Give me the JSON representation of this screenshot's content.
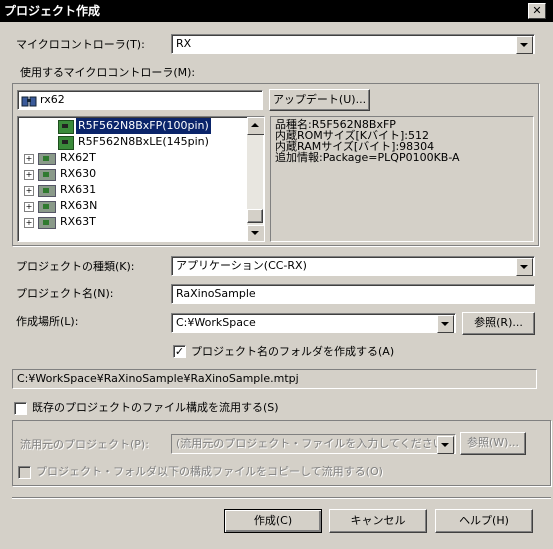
{
  "window": {
    "title": "プロジェクト作成",
    "close_glyph": "✕"
  },
  "microcontroller": {
    "label": "マイクロコントローラ(T):",
    "value": "RX"
  },
  "used_mc": {
    "label": "使用するマイクロコントローラ(M):",
    "search_value": "rx62",
    "update_button": "アップデート(U)...",
    "tree": [
      {
        "label": "R5F562N8BxFP(100pin)",
        "selected": true
      },
      {
        "label": "R5F562N8BxLE(145pin)",
        "selected": false
      },
      {
        "label": "RX62T"
      },
      {
        "label": "RX630"
      },
      {
        "label": "RX631"
      },
      {
        "label": "RX63N"
      },
      {
        "label": "RX63T"
      }
    ],
    "info": [
      "品種名:R5F562N8BxFP",
      "内蔵ROMサイズ[Kバイト]:512",
      "内蔵RAMサイズ[バイト]:98304",
      "追加情報:Package=PLQP0100KB-A"
    ]
  },
  "project_type": {
    "label": "プロジェクトの種類(K):",
    "value": "アプリケーション(CC-RX)"
  },
  "project_name": {
    "label": "プロジェクト名(N):",
    "value": "RaXinoSample"
  },
  "location": {
    "label": "作成場所(L):",
    "value": "C:¥WorkSpace",
    "browse_button": "参照(R)..."
  },
  "create_folder": {
    "label": "プロジェクト名のフォルダを作成する(A)",
    "checked": "✓"
  },
  "project_path": "C:¥WorkSpace¥RaXinoSample¥RaXinoSample.mtpj",
  "reuse": {
    "label": "既存のプロジェクトのファイル構成を流用する(S)",
    "source_label": "流用元のプロジェクト(P):",
    "source_placeholder": "(流用元のプロジェクト・ファイルを入力してください)",
    "browse_button": "参照(W)...",
    "copy_label": "プロジェクト・フォルダ以下の構成ファイルをコピーして流用する(O)"
  },
  "buttons": {
    "create": "作成(C)",
    "cancel": "キャンセル",
    "help": "ヘルプ(H)"
  }
}
